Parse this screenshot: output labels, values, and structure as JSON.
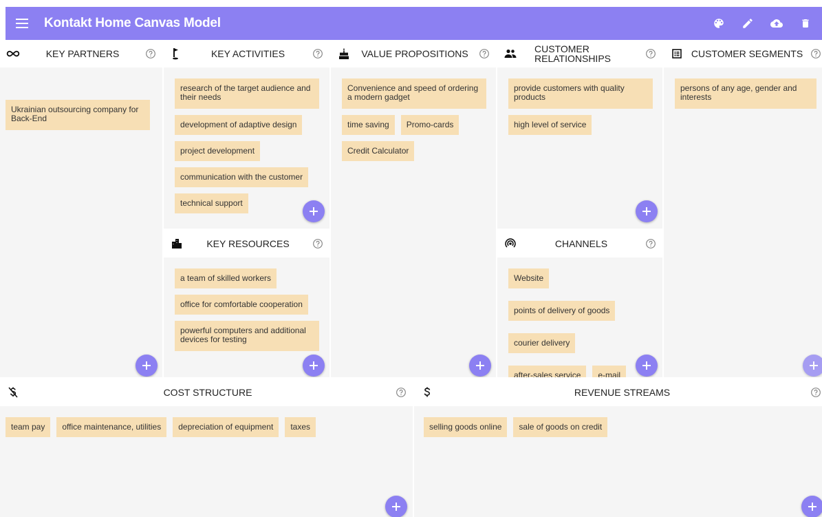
{
  "app": {
    "title": "Kontakt Home Canvas Model",
    "brand_color": "#8c80f2",
    "sticker_color": "#f7dfb5"
  },
  "toolbar": {
    "menu_icon": "menu-icon",
    "actions": [
      "palette-icon",
      "edit-icon",
      "cloud-upload-icon",
      "delete-icon"
    ]
  },
  "blocks": {
    "key_partners": {
      "title": "KEY PARTNERS",
      "icon": "infinity-icon",
      "stickers": [
        "Ukrainian outsourcing company for Back-End"
      ]
    },
    "key_activities": {
      "title": "KEY ACTIVITIES",
      "icon": "golf-flag-icon",
      "stickers": [
        "research of the target audience and their needs",
        "development of adaptive design",
        "project development",
        "communication with the customer",
        "technical support"
      ]
    },
    "key_resources": {
      "title": "KEY RESOURCES",
      "icon": "buildings-icon",
      "stickers": [
        "a team of skilled workers",
        "office for comfortable cooperation",
        "powerful computers and additional devices for testing"
      ]
    },
    "value_propositions": {
      "title": "VALUE PROPOSITIONS",
      "icon": "cake-icon",
      "stickers": [
        "Convenience and speed of ordering a modern gadget",
        "time saving",
        "Promo-cards",
        "Credit Calculator"
      ]
    },
    "customer_relationships": {
      "title": "CUSTOMER RELATIONSHIPS",
      "icon": "people-icon",
      "stickers": [
        "provide customers with quality products",
        "high level of service"
      ]
    },
    "channels": {
      "title": "CHANNELS",
      "icon": "broadcast-icon",
      "stickers": [
        "Website",
        "points of delivery of goods",
        "courier delivery",
        "after-sales service",
        "e-mail"
      ]
    },
    "customer_segments": {
      "title": "CUSTOMER SEGMENTS",
      "icon": "list-box-icon",
      "stickers": [
        "persons of any age, gender and interests"
      ]
    },
    "cost_structure": {
      "title": "COST STRUCTURE",
      "icon": "money-off-icon",
      "stickers": [
        "team pay",
        "office maintenance, utilities",
        "depreciation of equipment",
        "taxes"
      ]
    },
    "revenue_streams": {
      "title": "REVENUE STREAMS",
      "icon": "dollar-icon",
      "stickers": [
        "selling goods online",
        "sale of goods on credit"
      ]
    }
  }
}
